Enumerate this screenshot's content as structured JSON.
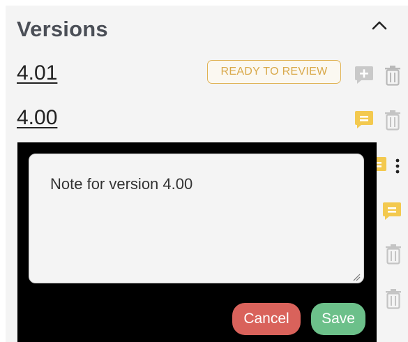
{
  "header": {
    "title": "Versions"
  },
  "versions": [
    {
      "label": "4.01",
      "status": "READY TO REVIEW",
      "note_icon": "add-note-icon"
    },
    {
      "label": "4.00",
      "note_icon": "note-icon"
    }
  ],
  "note_editor": {
    "text": "Note for version 4.00",
    "cancel_label": "Cancel",
    "save_label": "Save"
  },
  "colors": {
    "panel_bg": "#f4f4f4",
    "badge": "#e0b253",
    "note_yellow": "#f3c94f",
    "cancel": "#d9625b",
    "save": "#6cc08a"
  }
}
